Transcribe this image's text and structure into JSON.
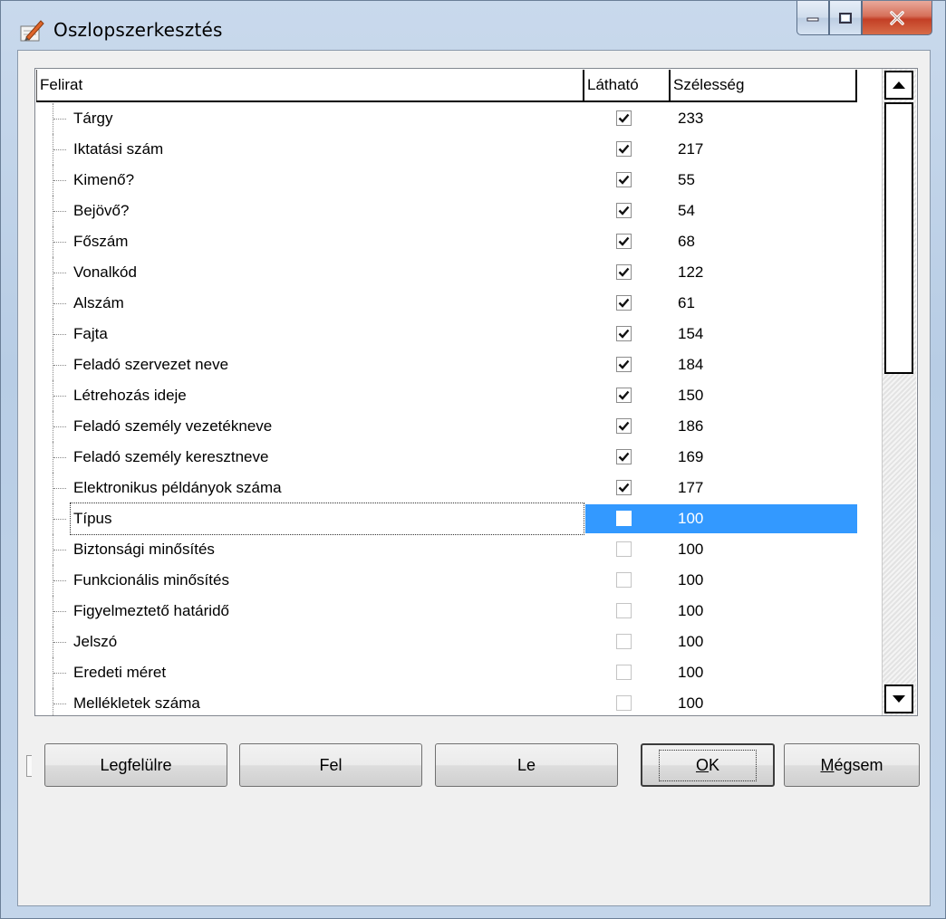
{
  "window": {
    "title": "Oszlopszerkesztés"
  },
  "columns": {
    "caption": "Felirat",
    "visible": "Látható",
    "width": "Szélesség"
  },
  "rows": [
    {
      "label": "Tárgy",
      "visible": true,
      "width": "233"
    },
    {
      "label": "Iktatási szám",
      "visible": true,
      "width": "217"
    },
    {
      "label": "Kimenő?",
      "visible": true,
      "width": "55"
    },
    {
      "label": "Bejövő?",
      "visible": true,
      "width": "54"
    },
    {
      "label": "Főszám",
      "visible": true,
      "width": "68"
    },
    {
      "label": "Vonalkód",
      "visible": true,
      "width": "122"
    },
    {
      "label": "Alszám",
      "visible": true,
      "width": "61"
    },
    {
      "label": "Fajta",
      "visible": true,
      "width": "154"
    },
    {
      "label": "Feladó szervezet neve",
      "visible": true,
      "width": "184"
    },
    {
      "label": "Létrehozás ideje",
      "visible": true,
      "width": "150"
    },
    {
      "label": "Feladó személy vezetékneve",
      "visible": true,
      "width": "186"
    },
    {
      "label": "Feladó személy keresztneve",
      "visible": true,
      "width": "169"
    },
    {
      "label": "Elektronikus példányok száma",
      "visible": true,
      "width": "177"
    },
    {
      "label": "Típus",
      "visible": false,
      "width": "100",
      "selected": true
    },
    {
      "label": "Biztonsági minősítés",
      "visible": false,
      "width": "100"
    },
    {
      "label": "Funkcionális minősítés",
      "visible": false,
      "width": "100"
    },
    {
      "label": "Figyelmeztető határidő",
      "visible": false,
      "width": "100"
    },
    {
      "label": "Jelszó",
      "visible": false,
      "width": "100"
    },
    {
      "label": "Eredeti méret",
      "visible": false,
      "width": "100"
    },
    {
      "label": "Mellékletek száma",
      "visible": false,
      "width": "100"
    }
  ],
  "buttons": {
    "top": "Legfelülre",
    "up": "Fel",
    "down": "Le",
    "ok_u": "O",
    "ok_rest": "K",
    "cancel_u": "M",
    "cancel_rest": "égsem"
  },
  "colors": {
    "selection": "#3399ff"
  }
}
